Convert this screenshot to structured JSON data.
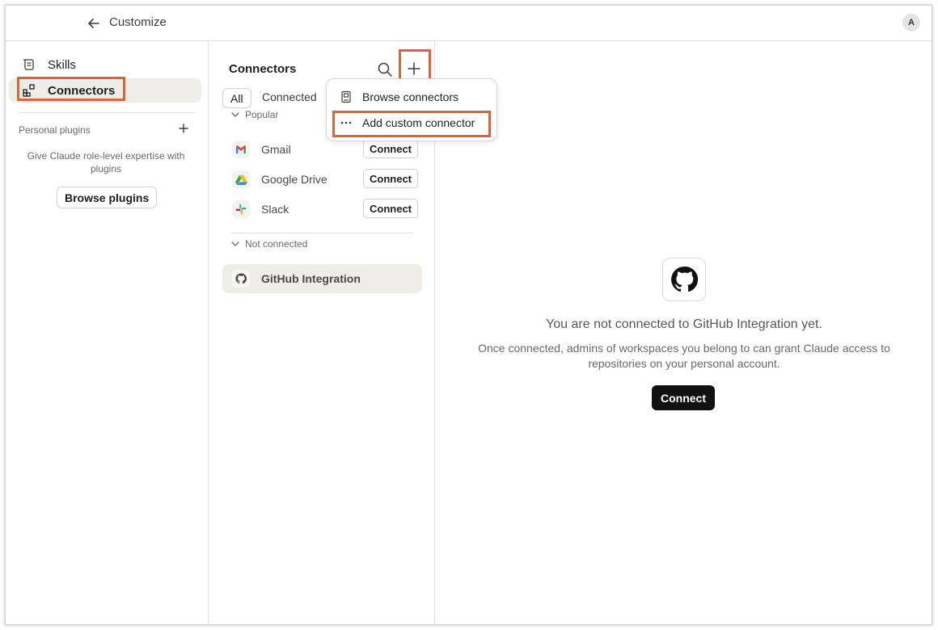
{
  "header": {
    "title": "Customize",
    "avatar_initial": "A"
  },
  "sidebar": {
    "items": [
      {
        "label": "Skills",
        "icon": "skills-icon"
      },
      {
        "label": "Connectors",
        "icon": "connectors-icon",
        "active": true
      }
    ],
    "plugins": {
      "title": "Personal plugins",
      "description": "Give Claude role-level expertise with plugins",
      "browse_label": "Browse plugins"
    }
  },
  "connectors": {
    "title": "Connectors",
    "tabs": [
      {
        "label": "All",
        "active": true
      },
      {
        "label": "Connected"
      }
    ],
    "sections": {
      "popular": "Popular",
      "not_connected": "Not connected"
    },
    "popular": [
      {
        "name": "Gmail",
        "action": "Connect",
        "icon": "gmail-icon"
      },
      {
        "name": "Google Drive",
        "action": "Connect",
        "icon": "google-drive-icon"
      },
      {
        "name": "Slack",
        "action": "Connect",
        "icon": "slack-icon"
      }
    ],
    "not_connected": [
      {
        "name": "GitHub Integration",
        "icon": "github-icon",
        "selected": true
      }
    ]
  },
  "menu": {
    "items": [
      {
        "label": "Browse connectors",
        "icon": "book-icon"
      },
      {
        "label": "Add custom connector",
        "icon": "more-dots-icon"
      }
    ]
  },
  "detail": {
    "title": "You are not connected to GitHub Integration yet.",
    "description": "Once connected, admins of workspaces you belong to can grant Claude access to repositories on your personal account.",
    "connect_label": "Connect"
  },
  "colors": {
    "highlight": "#d9653b",
    "active_bg": "#efede8",
    "primary_button": "#111111"
  }
}
